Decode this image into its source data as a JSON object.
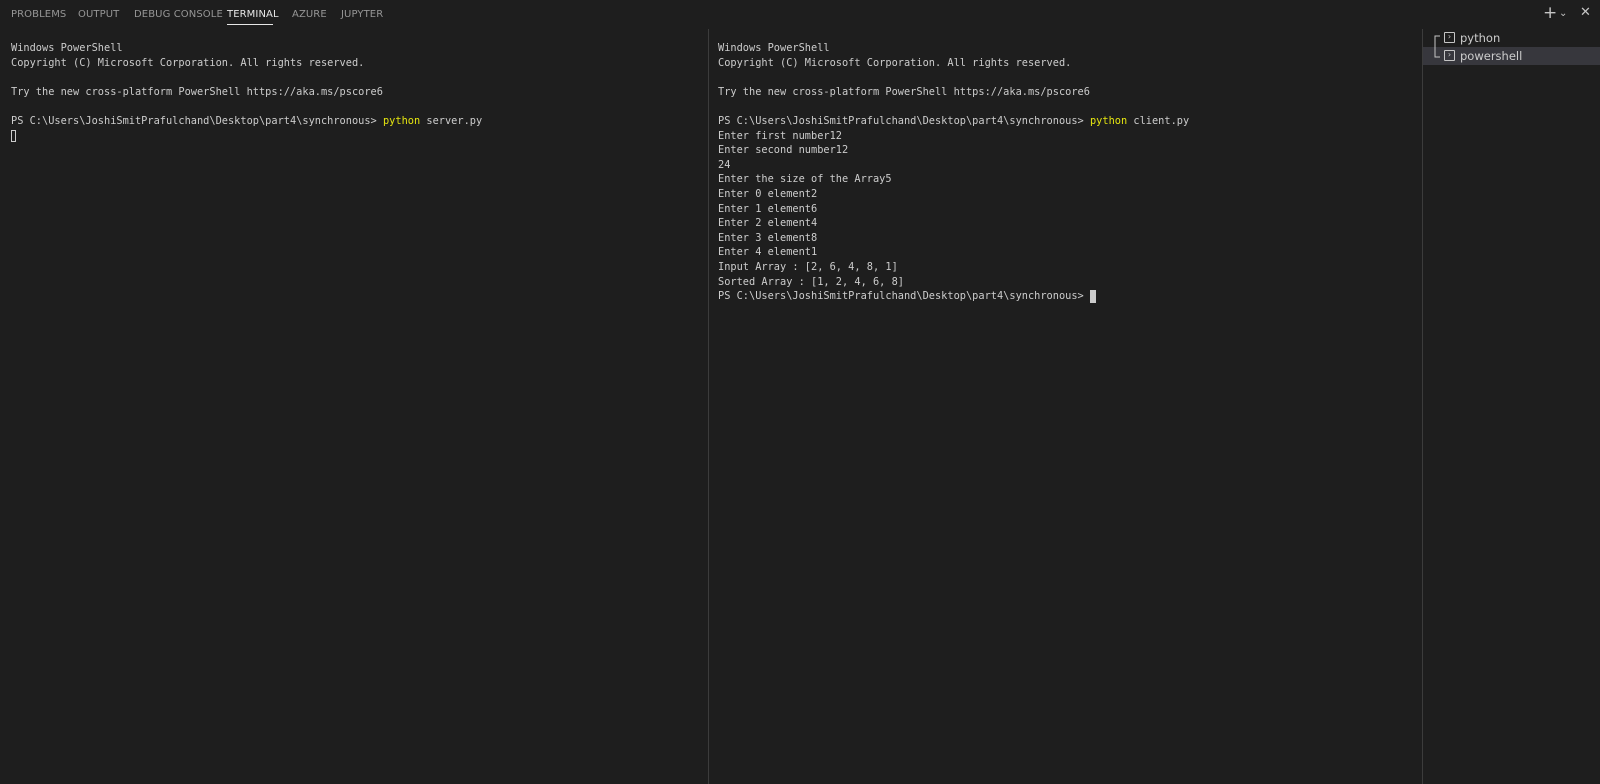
{
  "panel": {
    "tabs": [
      {
        "label": "PROBLEMS"
      },
      {
        "label": "OUTPUT"
      },
      {
        "label": "DEBUG CONSOLE"
      },
      {
        "label": "TERMINAL"
      },
      {
        "label": "AZURE"
      },
      {
        "label": "JUPYTER"
      }
    ],
    "active_tab": "TERMINAL",
    "actions": [
      {
        "name": "new-terminal",
        "icon": "plus-icon"
      },
      {
        "name": "terminal-dropdown",
        "icon": "chevron-down-icon"
      },
      {
        "name": "close-panel",
        "icon": "close-icon"
      }
    ]
  },
  "terminals": {
    "left": {
      "lines": [
        "Windows PowerShell",
        "Copyright (C) Microsoft Corporation. All rights reserved.",
        "",
        "Try the new cross-platform PowerShell https://aka.ms/pscore6",
        "",
        "PS C:\\Users\\JoshiSmitPrafulchand\\Desktop\\part4\\synchronous> "
      ],
      "command_keyword": "python",
      "command_args": " server.py"
    },
    "right": {
      "lines_before": [
        "Windows PowerShell",
        "Copyright (C) Microsoft Corporation. All rights reserved.",
        "",
        "Try the new cross-platform PowerShell https://aka.ms/pscore6",
        "",
        "PS C:\\Users\\JoshiSmitPrafulchand\\Desktop\\part4\\synchronous> "
      ],
      "command_keyword": "python",
      "command_args": " client.py",
      "output": [
        "Enter first number12",
        "Enter second number12",
        "24",
        "Enter the size of the Array5",
        "Enter 0 element2",
        "Enter 1 element6",
        "Enter 2 element4",
        "Enter 3 element8",
        "Enter 4 element1",
        "Input Array : [2, 6, 4, 8, 1]",
        "Sorted Array : [1, 2, 4, 6, 8]"
      ],
      "final_prompt": "PS C:\\Users\\JoshiSmitPrafulchand\\Desktop\\part4\\synchronous> "
    }
  },
  "sidebar": {
    "terminals": [
      {
        "label": "python",
        "icon": "terminal-icon",
        "selected": false
      },
      {
        "label": "powershell",
        "icon": "terminal-icon",
        "selected": true
      }
    ]
  },
  "colors": {
    "background": "#1e1e1e",
    "text": "#cccccc",
    "command_keyword": "#e5e510",
    "selected_item": "#37373d"
  }
}
